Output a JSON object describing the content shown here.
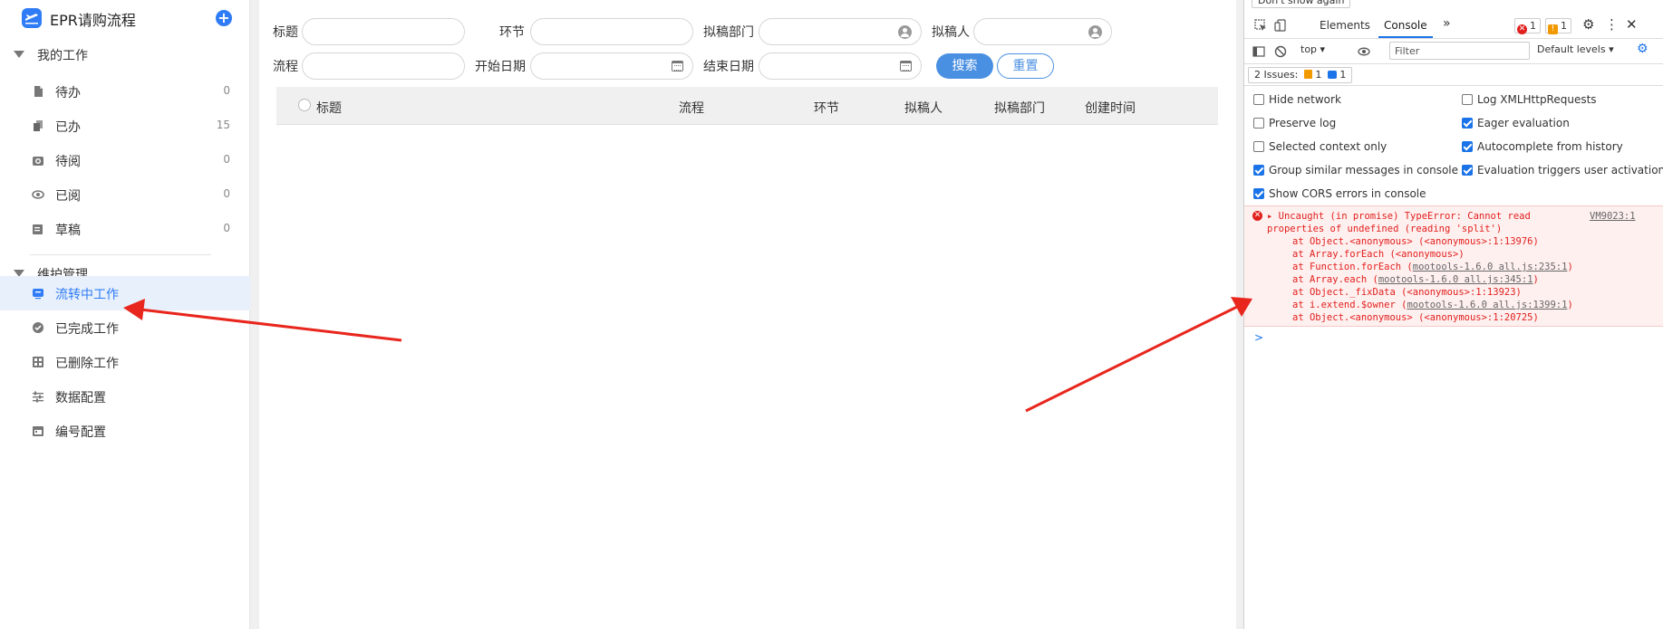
{
  "app": {
    "title": "EPR请购流程"
  },
  "sidebar": {
    "groups": [
      {
        "label": "我的工作"
      },
      {
        "label": "维护管理"
      }
    ],
    "work_items": [
      {
        "label": "待办",
        "count": "0"
      },
      {
        "label": "已办",
        "count": "15"
      },
      {
        "label": "待阅",
        "count": "0"
      },
      {
        "label": "已阅",
        "count": "0"
      },
      {
        "label": "草稿",
        "count": "0"
      }
    ],
    "admin_items": [
      {
        "label": "流转中工作"
      },
      {
        "label": "已完成工作"
      },
      {
        "label": "已删除工作"
      },
      {
        "label": "数据配置"
      },
      {
        "label": "编号配置"
      }
    ]
  },
  "filters": {
    "title_label": "标题",
    "node_label": "环节",
    "dept_label": "拟稿部门",
    "drafter_label": "拟稿人",
    "process_label": "流程",
    "start_date_label": "开始日期",
    "end_date_label": "结束日期",
    "search_button": "搜索",
    "reset_button": "重置"
  },
  "table": {
    "columns": [
      "标题",
      "流程",
      "环节",
      "拟稿人",
      "拟稿部门",
      "创建时间"
    ]
  },
  "devtools": {
    "dont_show_again": "Don't show again",
    "tabs": [
      "Elements",
      "Console"
    ],
    "active_tab": "Console",
    "error_count": "1",
    "warning_count": "1",
    "context": "top",
    "filter_placeholder": "Filter",
    "levels": "Default levels",
    "issues_label": "2 Issues:",
    "issues_warn": "1",
    "issues_info": "1",
    "options": [
      {
        "label": "Hide network",
        "checked": false
      },
      {
        "label": "Log XMLHttpRequests",
        "checked": false
      },
      {
        "label": "Preserve log",
        "checked": false
      },
      {
        "label": "Eager evaluation",
        "checked": true
      },
      {
        "label": "Selected context only",
        "checked": false
      },
      {
        "label": "Autocomplete from history",
        "checked": true
      },
      {
        "label": "Group similar messages in console",
        "checked": true
      },
      {
        "label": "Evaluation triggers user activation",
        "checked": true
      },
      {
        "label": "Show CORS errors in console",
        "checked": true
      }
    ],
    "error": {
      "source": "VM9023:1",
      "line1": "Uncaught (in promise) TypeError: Cannot read",
      "line2": "properties of undefined (reading 'split')",
      "stack": [
        {
          "pre": "at Object.<anonymous> (<anonymous>:1:13976)",
          "link": ""
        },
        {
          "pre": "at Array.forEach (<anonymous>)",
          "link": ""
        },
        {
          "pre": "at Function.forEach (",
          "link": "mootools-1.6.0 all.js:235:1",
          "post": ")"
        },
        {
          "pre": "at Array.each (",
          "link": "mootools-1.6.0 all.js:345:1",
          "post": ")"
        },
        {
          "pre": "at Object._fixData (<anonymous>:1:13923)",
          "link": ""
        },
        {
          "pre": "at i.extend.$owner (",
          "link": "mootools-1.6.0 all.js:1399:1",
          "post": ")"
        },
        {
          "pre": "at Object.<anonymous> (<anonymous>:1:20725)",
          "link": ""
        }
      ]
    },
    "prompt_symbol": ">"
  },
  "colors": {
    "accent": "#2f7cf6",
    "button": "#4a90e2",
    "error": "#e0201c",
    "arrow": "#e8261d"
  }
}
